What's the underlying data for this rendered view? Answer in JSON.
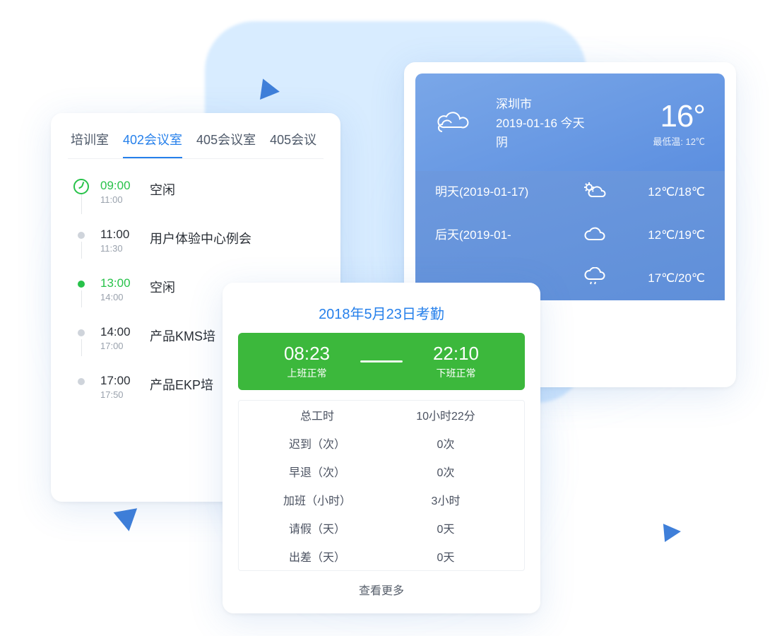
{
  "weather": {
    "city": "深圳市",
    "date_text": "2019-01-16 今天",
    "condition": "阴",
    "current_temp": "16°",
    "low_label": "最低温: 12℃",
    "forecast": [
      {
        "day": "明天(2019-01-17)",
        "icon": "sun-cloud",
        "range": "12℃/18℃"
      },
      {
        "day": "后天(2019-01-",
        "icon": "cloud",
        "range": "12℃/19℃"
      },
      {
        "day": "",
        "icon": "rain",
        "range": "17℃/20℃"
      }
    ]
  },
  "meeting": {
    "tabs": [
      "培训室",
      "402会议室",
      "405会议室",
      "405会议"
    ],
    "active_tab": 1,
    "slots": [
      {
        "start": "09:00",
        "end": "11:00",
        "title": "空闲",
        "state": "clock"
      },
      {
        "start": "11:00",
        "end": "11:30",
        "title": "用户体验中心例会",
        "state": "dot"
      },
      {
        "start": "13:00",
        "end": "14:00",
        "title": "空闲",
        "state": "green"
      },
      {
        "start": "14:00",
        "end": "17:00",
        "title": "产品KMS培",
        "state": "dot"
      },
      {
        "start": "17:00",
        "end": "17:50",
        "title": "产品EKP培",
        "state": "dot"
      }
    ]
  },
  "attendance": {
    "title": "2018年5月23日考勤",
    "checkin_time": "08:23",
    "checkin_label": "上班正常",
    "checkout_time": "22:10",
    "checkout_label": "下班正常",
    "rows": [
      {
        "k": "总工时",
        "v": "10小时22分"
      },
      {
        "k": "迟到（次）",
        "v": "0次"
      },
      {
        "k": "早退（次）",
        "v": "0次"
      },
      {
        "k": "加班（小时）",
        "v": "3小时"
      },
      {
        "k": "请假（天）",
        "v": "0天"
      },
      {
        "k": "出差（天）",
        "v": "0天"
      }
    ],
    "more": "查看更多"
  }
}
